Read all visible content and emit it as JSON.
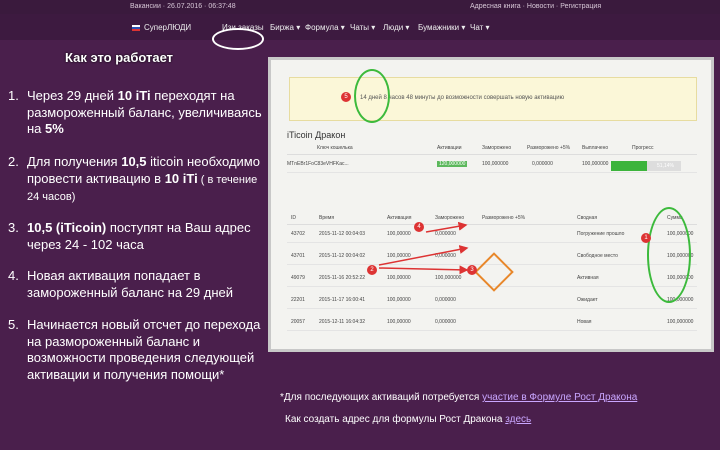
{
  "topbar": {
    "left": "Вакансии · 26.07.2016 · 06:37:48",
    "right": "Адресная книга · Новости · Регистрация"
  },
  "nav": {
    "items": [
      "СуперЛЮДИ",
      "Изи заказы",
      "Биржа ▾",
      "Формула ▾",
      "Чаты ▾",
      "Люди ▾",
      "Бумажники ▾",
      "Чат ▾"
    ]
  },
  "title": "Как это работает",
  "steps": [
    {
      "num": "1.",
      "parts": [
        "Через 29 дней ",
        "10 iTi",
        " переходят на размороженный баланс, увеличиваясь на ",
        "5%"
      ]
    },
    {
      "num": "2.",
      "parts": [
        "Для получения ",
        "10,5",
        " iticoin необходимо провести активацию в ",
        "10 iTi",
        " ( в течение 24 часов)"
      ]
    },
    {
      "num": "3.",
      "parts": [
        "",
        "10,5 (iTicoin)",
        " поступят на Ваш адрес через 24 - 102 часа"
      ]
    },
    {
      "num": "4.",
      "text": " Новая активация  попадает в замороженный баланс на 29 дней"
    },
    {
      "num": "5.",
      "text": "Начинается новый отсчет до перехода на  размороженный баланс и  возможности проведения следующей активации и получения помощи*"
    }
  ],
  "screenshot": {
    "banner": "14 дней 8 часов 48 минуты до возможности совершать новую активацию",
    "section_title": "iTicoin Дракон",
    "wallet_header": [
      "Ключ кошелька",
      "Активации",
      "Заморожено",
      "Разморожено +5%",
      "Выплачено",
      "Прогресс"
    ],
    "wallet_row": [
      "MTnEBr1FoC83eVHFKac...",
      "120,000000",
      "100,000000",
      "0,000000",
      "100,000000"
    ],
    "progress": {
      "value": 51.14,
      "label": "51,14%"
    },
    "table_header": [
      "ID",
      "Время",
      "Активация",
      "Заморожено",
      "Разморожено +5%",
      "Сводная",
      "Сумма"
    ],
    "rows": [
      [
        "43702",
        "2015-11-12 00:04:03",
        "100,00000",
        "0,000000",
        "Погружение прошло",
        "100,000000"
      ],
      [
        "43701",
        "2015-11-12 00:04:02",
        "100,00000",
        "0,000000",
        "Свободное место",
        "100,000000"
      ],
      [
        "49079",
        "2015-11-16 20:52:22",
        "100,00000",
        "100,000000",
        "Активная",
        "100,000000"
      ],
      [
        "22201",
        "2015-11-17 16:00:41",
        "100,00000",
        "0,000000",
        "Ожидает",
        "100,000000"
      ],
      [
        "20057",
        "2015-12-11 16:04:32",
        "100,00000",
        "0,000000",
        "Новая",
        "100,000000"
      ]
    ],
    "markers": [
      "5",
      "4",
      "3",
      "2",
      "1"
    ]
  },
  "footnote": {
    "text": "*Для последующих  активаций потребуется ",
    "link": "участие в Формуле Рост Дракона"
  },
  "footnote2": {
    "text": "Как создать адрес для формулы Рост Дракона ",
    "link": "здесь"
  },
  "colors": {
    "background": "#4a1f4c",
    "accent_green": "#3cba3c",
    "accent_orange": "#e8872a",
    "marker_red": "#dd3333"
  }
}
